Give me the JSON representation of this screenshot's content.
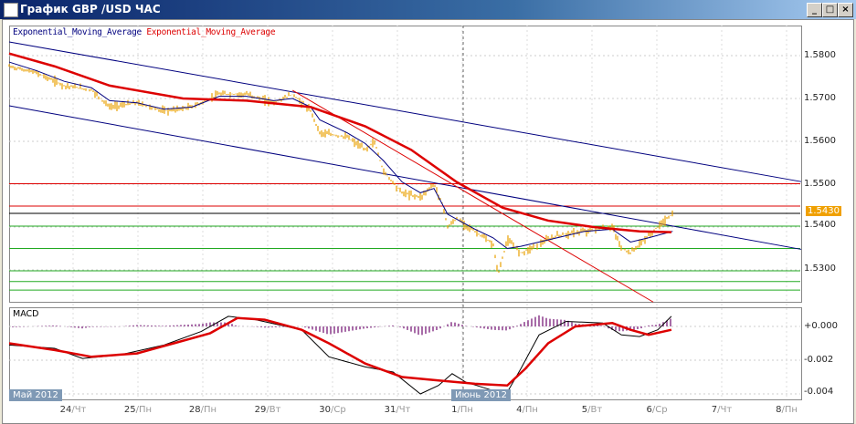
{
  "window": {
    "title": "График GBP /USD  ЧАС",
    "buttons": [
      "_",
      "□",
      "×"
    ]
  },
  "legend": {
    "ema1": "Exponential_Moving_Average",
    "ema2": "Exponential_Moving_Average"
  },
  "price_axis": {
    "labels": [
      "1.5800",
      "1.5700",
      "1.5600",
      "1.5500",
      "1.5400",
      "1.5300"
    ],
    "current": "1.5430"
  },
  "macd": {
    "label": "MACD",
    "axis": [
      "+0.000",
      "-0.002",
      "-0.004"
    ]
  },
  "months": {
    "may": "Май 2012",
    "june": "Июнь 2012"
  },
  "x_axis": [
    {
      "d": "24",
      "w": "/Чт"
    },
    {
      "d": "25",
      "w": "/Пн"
    },
    {
      "d": "28",
      "w": "/Пн"
    },
    {
      "d": "29",
      "w": "/Вт"
    },
    {
      "d": "30",
      "w": "/Ср"
    },
    {
      "d": "31",
      "w": "/Чт"
    },
    {
      "d": "1",
      "w": "/Пн"
    },
    {
      "d": "4",
      "w": "/Пн"
    },
    {
      "d": "5",
      "w": "/Вт"
    },
    {
      "d": "6",
      "w": "/Ср"
    },
    {
      "d": "7",
      "w": "/Чт"
    },
    {
      "d": "8",
      "w": "/Пн"
    }
  ],
  "colors": {
    "price": "#e8a000",
    "ema_fast": "#00007f",
    "ema_slow": "#dd0000",
    "hist": "#8b3a8b",
    "green": "#22aa22",
    "current": "#f0a000"
  },
  "chart_data": {
    "type": "line",
    "x_unit": "days from chart start",
    "ylim": [
      1.5225,
      1.5845
    ],
    "price": [
      [
        0,
        1.5775
      ],
      [
        0.42,
        1.576
      ],
      [
        0.85,
        1.573
      ],
      [
        1.27,
        1.572
      ],
      [
        1.55,
        1.568
      ],
      [
        1.97,
        1.569
      ],
      [
        2.39,
        1.567
      ],
      [
        2.82,
        1.568
      ],
      [
        3.24,
        1.571
      ],
      [
        3.66,
        1.571
      ],
      [
        4.08,
        1.569
      ],
      [
        4.37,
        1.571
      ],
      [
        4.65,
        1.567
      ],
      [
        4.79,
        1.562
      ],
      [
        5.21,
        1.561
      ],
      [
        5.49,
        1.558
      ],
      [
        5.63,
        1.56
      ],
      [
        5.77,
        1.553
      ],
      [
        6.06,
        1.548
      ],
      [
        6.34,
        1.547
      ],
      [
        6.55,
        1.55
      ],
      [
        6.69,
        1.545
      ],
      [
        6.76,
        1.54
      ],
      [
        6.9,
        1.542
      ],
      [
        7.18,
        1.539
      ],
      [
        7.46,
        1.536
      ],
      [
        7.54,
        1.529
      ],
      [
        7.68,
        1.537
      ],
      [
        7.89,
        1.534
      ],
      [
        8.17,
        1.536
      ],
      [
        8.45,
        1.538
      ],
      [
        8.87,
        1.539
      ],
      [
        9.3,
        1.54
      ],
      [
        9.44,
        1.535
      ],
      [
        9.58,
        1.534
      ],
      [
        9.86,
        1.538
      ],
      [
        10.14,
        1.542
      ],
      [
        10.23,
        1.543
      ]
    ],
    "ema_slow": [
      [
        0,
        1.5805
      ],
      [
        0.7,
        1.5775
      ],
      [
        1.55,
        1.573
      ],
      [
        2.68,
        1.57
      ],
      [
        3.66,
        1.5695
      ],
      [
        4.65,
        1.568
      ],
      [
        5.49,
        1.5635
      ],
      [
        6.2,
        1.558
      ],
      [
        6.9,
        1.5505
      ],
      [
        7.61,
        1.5445
      ],
      [
        8.31,
        1.5415
      ],
      [
        9.01,
        1.54
      ],
      [
        9.72,
        1.539
      ],
      [
        10.21,
        1.5388
      ]
    ],
    "ema_fast": [
      [
        0,
        1.5785
      ],
      [
        0.42,
        1.5765
      ],
      [
        0.85,
        1.574
      ],
      [
        1.27,
        1.5725
      ],
      [
        1.55,
        1.5695
      ],
      [
        1.97,
        1.569
      ],
      [
        2.39,
        1.5675
      ],
      [
        2.82,
        1.568
      ],
      [
        3.24,
        1.5705
      ],
      [
        3.66,
        1.5705
      ],
      [
        4.08,
        1.5695
      ],
      [
        4.37,
        1.57
      ],
      [
        4.65,
        1.568
      ],
      [
        4.79,
        1.565
      ],
      [
        5.21,
        1.562
      ],
      [
        5.49,
        1.5595
      ],
      [
        5.77,
        1.5555
      ],
      [
        6.06,
        1.5505
      ],
      [
        6.34,
        1.548
      ],
      [
        6.55,
        1.549
      ],
      [
        6.76,
        1.543
      ],
      [
        7.18,
        1.5395
      ],
      [
        7.46,
        1.5375
      ],
      [
        7.68,
        1.535
      ],
      [
        7.89,
        1.5355
      ],
      [
        8.45,
        1.5375
      ],
      [
        8.87,
        1.539
      ],
      [
        9.3,
        1.5395
      ],
      [
        9.58,
        1.5365
      ],
      [
        9.86,
        1.5375
      ],
      [
        10.23,
        1.539
      ]
    ],
    "trendlines": [
      {
        "color": "#00007f",
        "from": [
          0,
          1.5832
        ],
        "to": [
          12.21,
          1.5506
        ]
      },
      {
        "color": "#00007f",
        "from": [
          0,
          1.5683
        ],
        "to": [
          12.21,
          1.5348
        ]
      },
      {
        "color": "#dd0000",
        "from": [
          4.37,
          1.5719
        ],
        "to": [
          9.93,
          1.5225
        ]
      }
    ],
    "hlines": [
      {
        "v": 1.5501,
        "color": "#dd0000"
      },
      {
        "v": 1.5449,
        "color": "#dd0000"
      },
      {
        "v": 1.5432,
        "color": "#000000"
      },
      {
        "v": 1.5402,
        "color": "#22aa22"
      },
      {
        "v": 1.535,
        "color": "#22aa22"
      },
      {
        "v": 1.5298,
        "color": "#22aa22"
      },
      {
        "v": 1.5273,
        "color": "#22aa22"
      },
      {
        "v": 1.5253,
        "color": "#22aa22"
      }
    ],
    "macd_ylim": [
      -0.0045,
      0.0008
    ],
    "macd_line": [
      [
        0,
        -0.0011
      ],
      [
        0.7,
        -0.0013
      ],
      [
        1.13,
        -0.0019
      ],
      [
        1.69,
        -0.0017
      ],
      [
        2.39,
        -0.0011
      ],
      [
        2.96,
        -0.0003
      ],
      [
        3.38,
        0.0006
      ],
      [
        3.8,
        0.0004
      ],
      [
        4.51,
        -0.0002
      ],
      [
        4.93,
        -0.0018
      ],
      [
        5.49,
        -0.0024
      ],
      [
        5.92,
        -0.0027
      ],
      [
        6.34,
        -0.004
      ],
      [
        6.62,
        -0.0035
      ],
      [
        6.83,
        -0.0028
      ],
      [
        7.04,
        -0.0033
      ],
      [
        7.46,
        -0.0038
      ],
      [
        7.68,
        -0.0039
      ],
      [
        7.89,
        -0.0025
      ],
      [
        8.17,
        -0.0005
      ],
      [
        8.59,
        0.0003
      ],
      [
        9.15,
        0.0002
      ],
      [
        9.44,
        -0.0005
      ],
      [
        9.72,
        -0.0006
      ],
      [
        10.0,
        -0.0002
      ],
      [
        10.21,
        0.0006
      ]
    ],
    "macd_signal": [
      [
        0,
        -0.001
      ],
      [
        0.7,
        -0.0014
      ],
      [
        1.27,
        -0.0018
      ],
      [
        1.97,
        -0.0016
      ],
      [
        2.54,
        -0.001
      ],
      [
        3.1,
        -0.0004
      ],
      [
        3.52,
        0.0005
      ],
      [
        3.94,
        0.0004
      ],
      [
        4.51,
        -0.0002
      ],
      [
        4.93,
        -0.001
      ],
      [
        5.49,
        -0.0022
      ],
      [
        6.06,
        -0.003
      ],
      [
        6.62,
        -0.0032
      ],
      [
        7.18,
        -0.0034
      ],
      [
        7.68,
        -0.0035
      ],
      [
        7.96,
        -0.0025
      ],
      [
        8.31,
        -0.001
      ],
      [
        8.73,
        0
      ],
      [
        9.3,
        0.0002
      ],
      [
        9.58,
        -0.0002
      ],
      [
        9.86,
        -0.0005
      ],
      [
        10.21,
        -0.0002
      ]
    ]
  }
}
